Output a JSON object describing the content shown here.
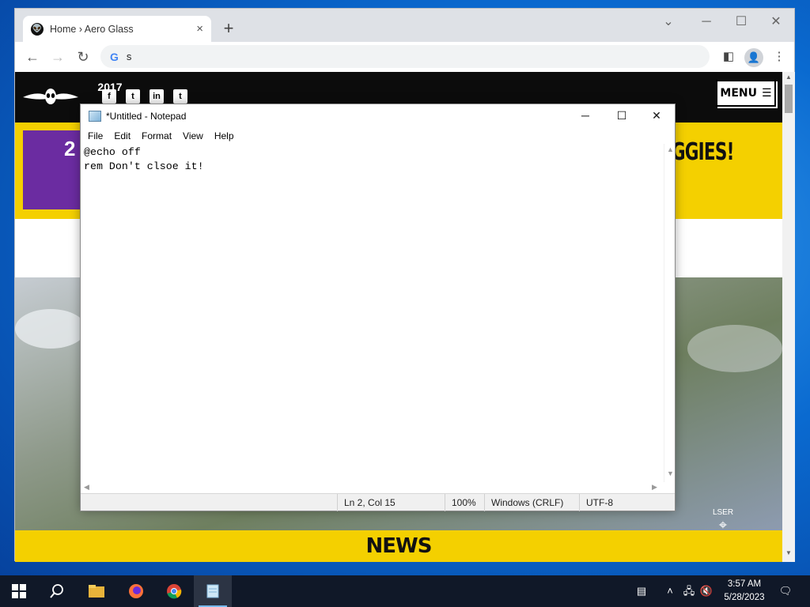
{
  "browser": {
    "tab_title": "Home › Aero Glass",
    "tab_close": "×",
    "new_tab": "+",
    "omnibox_text": "s",
    "window_controls": {
      "minimize": "─",
      "maximize": "☐",
      "close": "✕",
      "dropdown": "⌄"
    }
  },
  "site": {
    "award_year": "2017",
    "social": [
      "f",
      "t",
      "in",
      "t"
    ],
    "menu_label": "MENU",
    "headline_partial": "TH AUGGIES!",
    "award_badge": "2",
    "hud_label": "LSER",
    "news_label": "NEWS"
  },
  "notepad": {
    "title": "*Untitled - Notepad",
    "menu": [
      "File",
      "Edit",
      "Format",
      "View",
      "Help"
    ],
    "content": "@echo off\nrem Don't clsoe it!",
    "status": {
      "position": "Ln 2, Col 15",
      "zoom": "100%",
      "line_endings": "Windows (CRLF)",
      "encoding": "UTF-8"
    }
  },
  "taskbar": {
    "clock_time": "3:57 AM",
    "clock_date": "5/28/2023",
    "apps": [
      "start",
      "search",
      "file-explorer",
      "firefox",
      "chrome",
      "notepad"
    ]
  },
  "colors": {
    "site_yellow": "#f4d000",
    "award_purple": "#6b2ca1",
    "taskbar": "#101828"
  }
}
